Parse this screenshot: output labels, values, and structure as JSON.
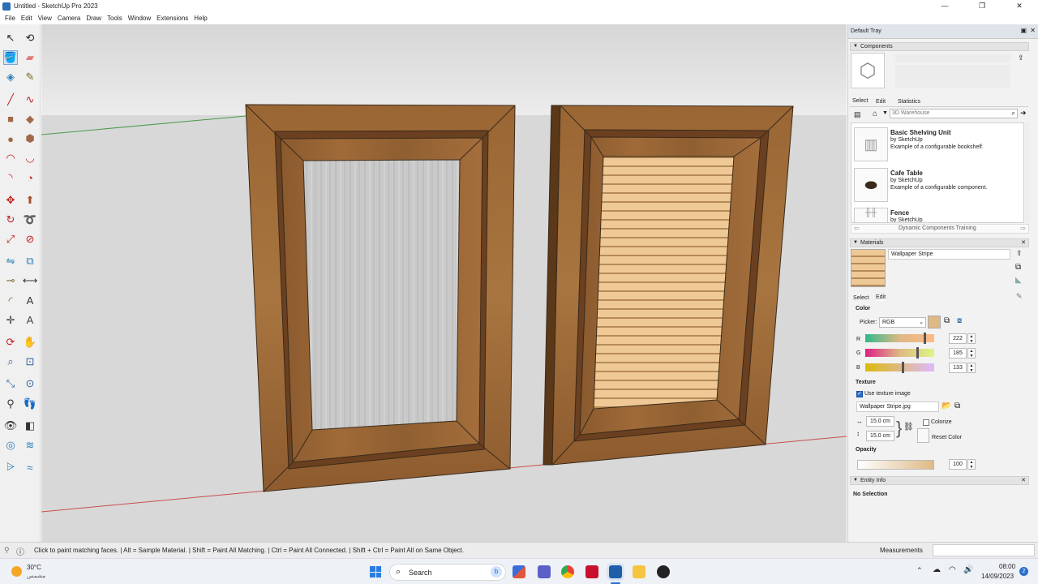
{
  "window": {
    "title": "Untitled - SketchUp Pro 2023",
    "minimize": "—",
    "maximize": "❐",
    "close": "✕"
  },
  "menu": [
    "File",
    "Edit",
    "View",
    "Camera",
    "Draw",
    "Tools",
    "Window",
    "Extensions",
    "Help"
  ],
  "tools": [
    {
      "name": "select-tool",
      "glyph": "↖",
      "color": "#222"
    },
    {
      "name": "orbit-tool",
      "glyph": "⟲",
      "color": "#222"
    },
    {
      "name": "paint-bucket-tool",
      "glyph": "🪣",
      "color": "#c46a1a",
      "active": true
    },
    {
      "name": "eraser-tool",
      "glyph": "▰",
      "color": "#e07a7a"
    },
    {
      "name": "make-component-tool",
      "glyph": "◈",
      "color": "#2f7fb5"
    },
    {
      "name": "tape-measure-tool",
      "glyph": "✎",
      "color": "#7a6a2a"
    },
    {
      "name": "line-tool",
      "glyph": "╱",
      "color": "#c02020"
    },
    {
      "name": "freehand-tool",
      "glyph": "∿",
      "color": "#c02020"
    },
    {
      "name": "rectangle-tool",
      "glyph": "■",
      "color": "#a06a4a"
    },
    {
      "name": "rotated-rectangle-tool",
      "glyph": "◆",
      "color": "#a06a4a"
    },
    {
      "name": "circle-tool",
      "glyph": "●",
      "color": "#a06a4a"
    },
    {
      "name": "polygon-tool",
      "glyph": "⬢",
      "color": "#a06a4a"
    },
    {
      "name": "arc-tool",
      "glyph": "◠",
      "color": "#c02020"
    },
    {
      "name": "two-point-arc-tool",
      "glyph": "◡",
      "color": "#c02020"
    },
    {
      "name": "three-point-arc-tool",
      "glyph": "◝",
      "color": "#c02020"
    },
    {
      "name": "pie-tool",
      "glyph": "◔",
      "color": "#c02020"
    },
    {
      "name": "move-tool",
      "glyph": "✥",
      "color": "#c02020"
    },
    {
      "name": "push-pull-tool",
      "glyph": "⬆",
      "color": "#a0502a"
    },
    {
      "name": "rotate-tool",
      "glyph": "↻",
      "color": "#c02020"
    },
    {
      "name": "follow-me-tool",
      "glyph": "➰",
      "color": "#c02020"
    },
    {
      "name": "scale-tool",
      "glyph": "⤢",
      "color": "#c02020"
    },
    {
      "name": "offset-tool",
      "glyph": "⊘",
      "color": "#c02020"
    },
    {
      "name": "flip-tool",
      "glyph": "⇋",
      "color": "#2f7fb5"
    },
    {
      "name": "solid-tools-tool",
      "glyph": "⧉",
      "color": "#2f7fb5"
    },
    {
      "name": "tape-measure-2-tool",
      "glyph": "⊸",
      "color": "#7a6a2a"
    },
    {
      "name": "dimension-tool",
      "glyph": "⟷",
      "color": "#333"
    },
    {
      "name": "protractor-tool",
      "glyph": "◜",
      "color": "#7a6a2a"
    },
    {
      "name": "text-tool",
      "glyph": "A",
      "color": "#333"
    },
    {
      "name": "axes-tool",
      "glyph": "✛",
      "color": "#333"
    },
    {
      "name": "3d-text-tool",
      "glyph": "A",
      "color": "#444"
    },
    {
      "name": "orbit-2-tool",
      "glyph": "⟳",
      "color": "#c02020"
    },
    {
      "name": "pan-tool",
      "glyph": "✋",
      "color": "#c07a2a"
    },
    {
      "name": "zoom-tool",
      "glyph": "⌕",
      "color": "#2f5f9f"
    },
    {
      "name": "zoom-window-tool",
      "glyph": "⊡",
      "color": "#2f5f9f"
    },
    {
      "name": "zoom-extents-tool",
      "glyph": "⤡",
      "color": "#2f5f9f"
    },
    {
      "name": "previous-view-tool",
      "glyph": "⊙",
      "color": "#2f5f9f"
    },
    {
      "name": "position-camera-tool",
      "glyph": "⚲",
      "color": "#333"
    },
    {
      "name": "walk-tool",
      "glyph": "👣",
      "color": "#333"
    },
    {
      "name": "look-around-tool",
      "glyph": "👁",
      "color": "#333"
    },
    {
      "name": "section-plane-tool",
      "glyph": "◧",
      "color": "#333"
    },
    {
      "name": "sandbox-from-contours-tool",
      "glyph": "◎",
      "color": "#2f7fb5"
    },
    {
      "name": "sandbox-from-scratch-tool",
      "glyph": "≋",
      "color": "#2f7fb5"
    },
    {
      "name": "smoove-tool",
      "glyph": "⩥",
      "color": "#2f7fb5"
    },
    {
      "name": "stamp-tool",
      "glyph": "≈",
      "color": "#2f7fb5"
    }
  ],
  "tray": {
    "title": "Default Tray",
    "components": {
      "header": "Components",
      "tabs": [
        "Select",
        "Edit",
        "Statistics"
      ],
      "search_placeholder": "3D Warehouse",
      "items": [
        {
          "name": "Basic Shelving Unit",
          "by": "by SketchUp",
          "desc": "Example of a configurable bookshelf."
        },
        {
          "name": "Cafe Table",
          "by": "by SketchUp",
          "desc": "Example of a configurable component."
        },
        {
          "name": "Fence",
          "by": "by SketchUp",
          "desc": ""
        }
      ],
      "collection": "Dynamic Components Training"
    },
    "materials": {
      "header": "Materials",
      "name": "Wallpaper Stripe",
      "tabs": [
        "Select",
        "Edit"
      ],
      "color_label": "Color",
      "picker_label": "Picker:",
      "picker_value": "RGB",
      "r_label": "R",
      "g_label": "G",
      "b_label": "B",
      "r": 222,
      "g": 185,
      "b": 133,
      "swatch": "#deb985",
      "texture_label": "Texture",
      "use_texture": "Use texture image",
      "texture_file": "Wallpaper Stripe.jpg",
      "width": "15.0 cm",
      "height": "15.0 cm",
      "colorize": "Colorize",
      "reset_color": "Reset Color",
      "opacity_label": "Opacity",
      "opacity": 100
    },
    "entity_info": {
      "header": "Entity Info",
      "status": "No Selection"
    }
  },
  "status": {
    "hint": "Click to paint matching faces. | Alt = Sample Material. | Shift = Paint All Matching. | Ctrl = Paint All Connected. | Shift + Ctrl = Paint All on Same Object.",
    "measurements_label": "Measurements"
  },
  "taskbar": {
    "weather_temp": "30°C",
    "weather_desc": "مشمس",
    "search_label": "Search",
    "time": "08:00",
    "date": "14/09/2023",
    "notification_count": "2"
  }
}
